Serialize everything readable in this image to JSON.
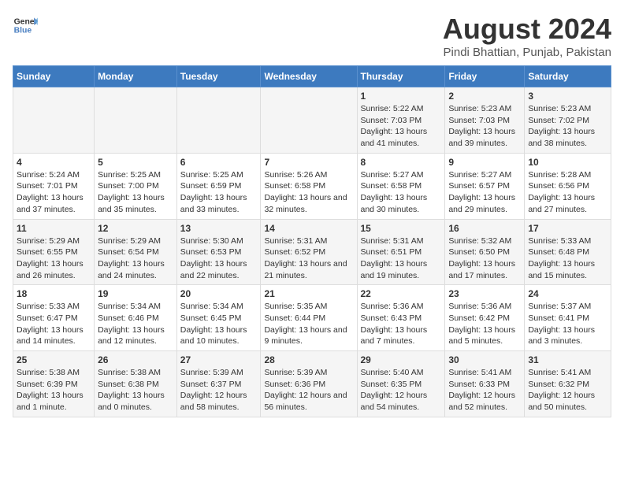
{
  "header": {
    "logo_line1": "General",
    "logo_line2": "Blue",
    "title": "August 2024",
    "subtitle": "Pindi Bhattian, Punjab, Pakistan"
  },
  "columns": [
    "Sunday",
    "Monday",
    "Tuesday",
    "Wednesday",
    "Thursday",
    "Friday",
    "Saturday"
  ],
  "weeks": [
    [
      {
        "day": "",
        "info": ""
      },
      {
        "day": "",
        "info": ""
      },
      {
        "day": "",
        "info": ""
      },
      {
        "day": "",
        "info": ""
      },
      {
        "day": "1",
        "info": "Sunrise: 5:22 AM\nSunset: 7:03 PM\nDaylight: 13 hours\nand 41 minutes."
      },
      {
        "day": "2",
        "info": "Sunrise: 5:23 AM\nSunset: 7:03 PM\nDaylight: 13 hours\nand 39 minutes."
      },
      {
        "day": "3",
        "info": "Sunrise: 5:23 AM\nSunset: 7:02 PM\nDaylight: 13 hours\nand 38 minutes."
      }
    ],
    [
      {
        "day": "4",
        "info": "Sunrise: 5:24 AM\nSunset: 7:01 PM\nDaylight: 13 hours\nand 37 minutes."
      },
      {
        "day": "5",
        "info": "Sunrise: 5:25 AM\nSunset: 7:00 PM\nDaylight: 13 hours\nand 35 minutes."
      },
      {
        "day": "6",
        "info": "Sunrise: 5:25 AM\nSunset: 6:59 PM\nDaylight: 13 hours\nand 33 minutes."
      },
      {
        "day": "7",
        "info": "Sunrise: 5:26 AM\nSunset: 6:58 PM\nDaylight: 13 hours\nand 32 minutes."
      },
      {
        "day": "8",
        "info": "Sunrise: 5:27 AM\nSunset: 6:58 PM\nDaylight: 13 hours\nand 30 minutes."
      },
      {
        "day": "9",
        "info": "Sunrise: 5:27 AM\nSunset: 6:57 PM\nDaylight: 13 hours\nand 29 minutes."
      },
      {
        "day": "10",
        "info": "Sunrise: 5:28 AM\nSunset: 6:56 PM\nDaylight: 13 hours\nand 27 minutes."
      }
    ],
    [
      {
        "day": "11",
        "info": "Sunrise: 5:29 AM\nSunset: 6:55 PM\nDaylight: 13 hours\nand 26 minutes."
      },
      {
        "day": "12",
        "info": "Sunrise: 5:29 AM\nSunset: 6:54 PM\nDaylight: 13 hours\nand 24 minutes."
      },
      {
        "day": "13",
        "info": "Sunrise: 5:30 AM\nSunset: 6:53 PM\nDaylight: 13 hours\nand 22 minutes."
      },
      {
        "day": "14",
        "info": "Sunrise: 5:31 AM\nSunset: 6:52 PM\nDaylight: 13 hours\nand 21 minutes."
      },
      {
        "day": "15",
        "info": "Sunrise: 5:31 AM\nSunset: 6:51 PM\nDaylight: 13 hours\nand 19 minutes."
      },
      {
        "day": "16",
        "info": "Sunrise: 5:32 AM\nSunset: 6:50 PM\nDaylight: 13 hours\nand 17 minutes."
      },
      {
        "day": "17",
        "info": "Sunrise: 5:33 AM\nSunset: 6:48 PM\nDaylight: 13 hours\nand 15 minutes."
      }
    ],
    [
      {
        "day": "18",
        "info": "Sunrise: 5:33 AM\nSunset: 6:47 PM\nDaylight: 13 hours\nand 14 minutes."
      },
      {
        "day": "19",
        "info": "Sunrise: 5:34 AM\nSunset: 6:46 PM\nDaylight: 13 hours\nand 12 minutes."
      },
      {
        "day": "20",
        "info": "Sunrise: 5:34 AM\nSunset: 6:45 PM\nDaylight: 13 hours\nand 10 minutes."
      },
      {
        "day": "21",
        "info": "Sunrise: 5:35 AM\nSunset: 6:44 PM\nDaylight: 13 hours\nand 9 minutes."
      },
      {
        "day": "22",
        "info": "Sunrise: 5:36 AM\nSunset: 6:43 PM\nDaylight: 13 hours\nand 7 minutes."
      },
      {
        "day": "23",
        "info": "Sunrise: 5:36 AM\nSunset: 6:42 PM\nDaylight: 13 hours\nand 5 minutes."
      },
      {
        "day": "24",
        "info": "Sunrise: 5:37 AM\nSunset: 6:41 PM\nDaylight: 13 hours\nand 3 minutes."
      }
    ],
    [
      {
        "day": "25",
        "info": "Sunrise: 5:38 AM\nSunset: 6:39 PM\nDaylight: 13 hours\nand 1 minute."
      },
      {
        "day": "26",
        "info": "Sunrise: 5:38 AM\nSunset: 6:38 PM\nDaylight: 13 hours\nand 0 minutes."
      },
      {
        "day": "27",
        "info": "Sunrise: 5:39 AM\nSunset: 6:37 PM\nDaylight: 12 hours\nand 58 minutes."
      },
      {
        "day": "28",
        "info": "Sunrise: 5:39 AM\nSunset: 6:36 PM\nDaylight: 12 hours\nand 56 minutes."
      },
      {
        "day": "29",
        "info": "Sunrise: 5:40 AM\nSunset: 6:35 PM\nDaylight: 12 hours\nand 54 minutes."
      },
      {
        "day": "30",
        "info": "Sunrise: 5:41 AM\nSunset: 6:33 PM\nDaylight: 12 hours\nand 52 minutes."
      },
      {
        "day": "31",
        "info": "Sunrise: 5:41 AM\nSunset: 6:32 PM\nDaylight: 12 hours\nand 50 minutes."
      }
    ]
  ]
}
